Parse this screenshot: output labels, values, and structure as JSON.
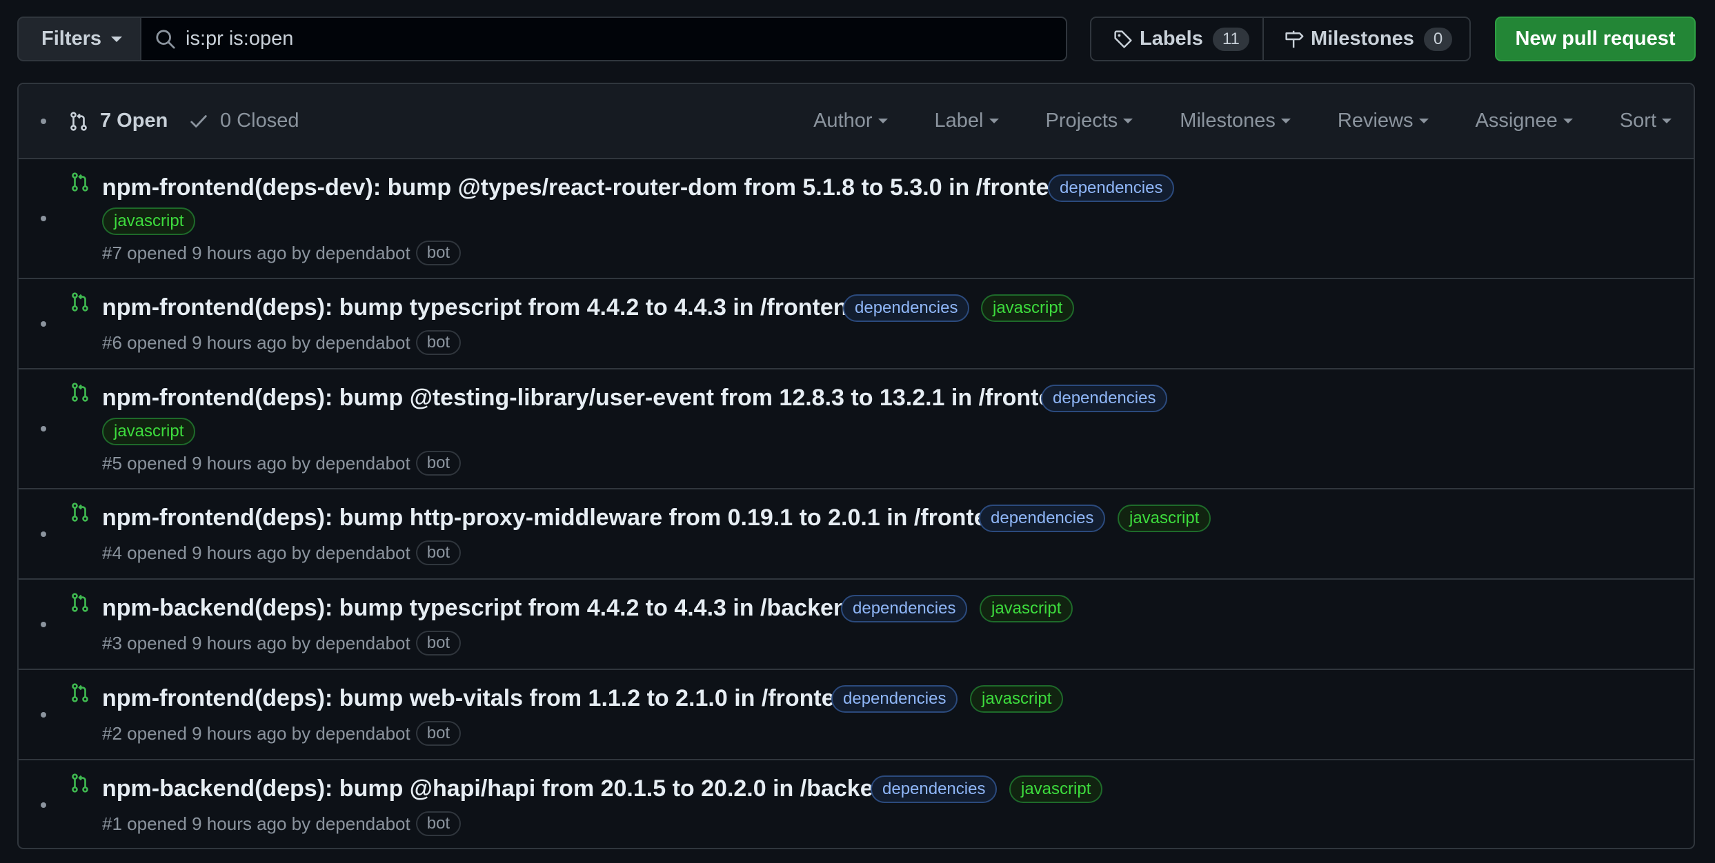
{
  "toolbar": {
    "filters_label": "Filters",
    "search_value": "is:pr is:open",
    "labels_label": "Labels",
    "labels_count": "11",
    "milestones_label": "Milestones",
    "milestones_count": "0",
    "new_pr_label": "New pull request"
  },
  "list_header": {
    "open_label": "7 Open",
    "closed_label": "0 Closed",
    "filters": [
      "Author",
      "Label",
      "Projects",
      "Milestones",
      "Reviews",
      "Assignee",
      "Sort"
    ]
  },
  "pull_requests": [
    {
      "title": "npm-frontend(deps-dev): bump @types/react-router-dom from 5.1.8 to 5.3.0 in /frontend",
      "labels": [
        "dependencies",
        "javascript"
      ],
      "meta": "#7 opened 9 hours ago by dependabot",
      "badge": "bot"
    },
    {
      "title": "npm-frontend(deps): bump typescript from 4.4.2 to 4.4.3 in /frontend",
      "labels": [
        "dependencies",
        "javascript"
      ],
      "meta": "#6 opened 9 hours ago by dependabot",
      "badge": "bot"
    },
    {
      "title": "npm-frontend(deps): bump @testing-library/user-event from 12.8.3 to 13.2.1 in /frontend",
      "labels": [
        "dependencies",
        "javascript"
      ],
      "meta": "#5 opened 9 hours ago by dependabot",
      "badge": "bot"
    },
    {
      "title": "npm-frontend(deps): bump http-proxy-middleware from 0.19.1 to 2.0.1 in /frontend",
      "labels": [
        "dependencies",
        "javascript"
      ],
      "meta": "#4 opened 9 hours ago by dependabot",
      "badge": "bot"
    },
    {
      "title": "npm-backend(deps): bump typescript from 4.4.2 to 4.4.3 in /backend",
      "labels": [
        "dependencies",
        "javascript"
      ],
      "meta": "#3 opened 9 hours ago by dependabot",
      "badge": "bot"
    },
    {
      "title": "npm-frontend(deps): bump web-vitals from 1.1.2 to 2.1.0 in /frontend",
      "labels": [
        "dependencies",
        "javascript"
      ],
      "meta": "#2 opened 9 hours ago by dependabot",
      "badge": "bot"
    },
    {
      "title": "npm-backend(deps): bump @hapi/hapi from 20.1.5 to 20.2.0 in /backend",
      "labels": [
        "dependencies",
        "javascript"
      ],
      "meta": "#1 opened 9 hours ago by dependabot",
      "badge": "bot"
    }
  ],
  "colors": {
    "background": "#0d1117",
    "open_icon": "#3fb950",
    "primary_button": "#238636",
    "label_dependencies": "#8fb6f7",
    "label_javascript": "#3ddc3d"
  }
}
